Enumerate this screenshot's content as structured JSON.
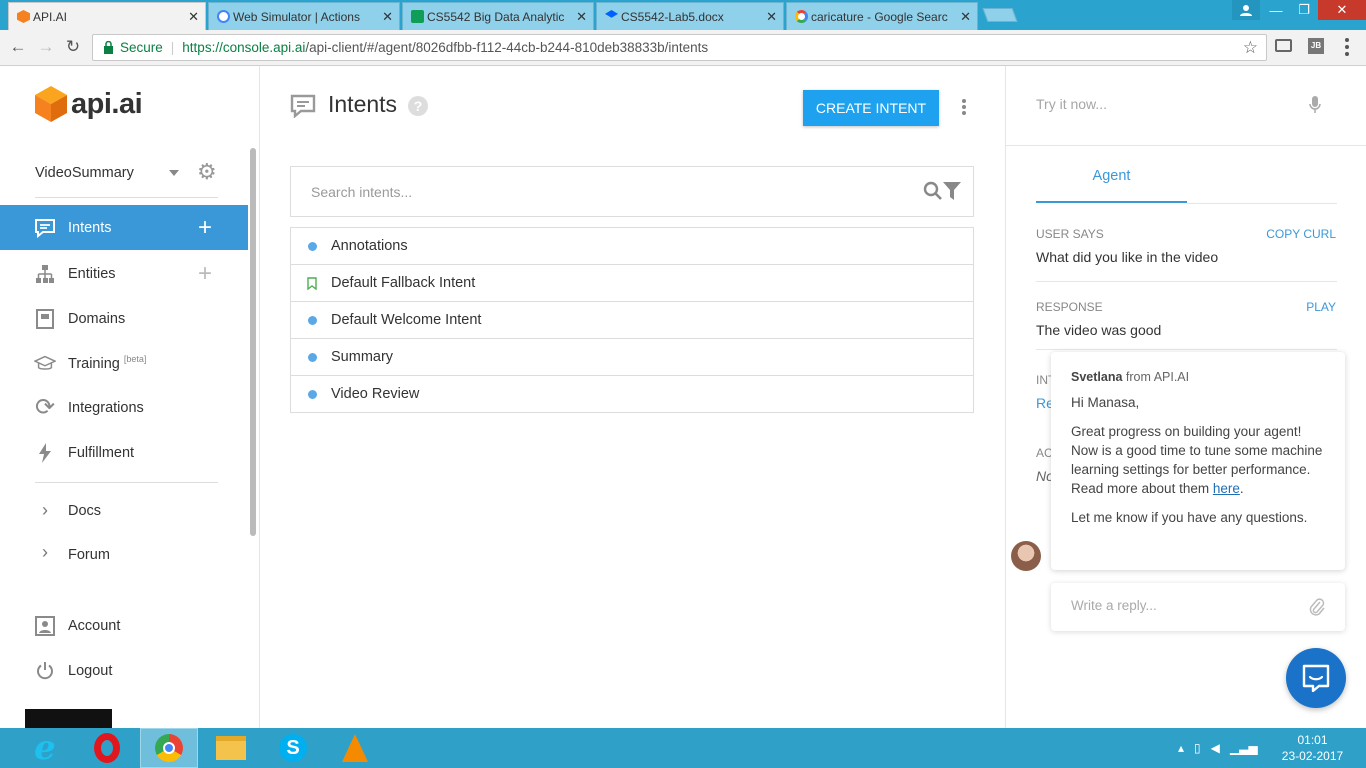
{
  "browser": {
    "tabs": [
      {
        "title": "API.AI",
        "active": true,
        "favicon": "api-ai-icon",
        "color": "#f5821f"
      },
      {
        "title": "Web Simulator  |  Actions",
        "active": false,
        "favicon": "globe-icon",
        "color": "#4285f4"
      },
      {
        "title": "CS5542 Big Data Analytic",
        "active": false,
        "favicon": "sheets-icon",
        "color": "#0f9d58"
      },
      {
        "title": "CS5542-Lab5.docx",
        "active": false,
        "favicon": "dropbox-icon",
        "color": "#0061fe"
      },
      {
        "title": "caricature - Google Searc",
        "active": false,
        "favicon": "google-icon",
        "color": "#ea4335"
      }
    ],
    "close_glyph": "✕",
    "window_controls": {
      "minimize": "—",
      "restore": "❐",
      "close": "✕"
    },
    "secure_label": "Secure",
    "url_scheme_host": "https://console.api.ai",
    "url_path": "/api-client/#/agent/8026dfbb-f112-44cb-b244-810deb38833b/intents"
  },
  "sidebar": {
    "logo_text": "api.ai",
    "agent_name": "VideoSummary",
    "items": [
      {
        "label": "Intents",
        "icon": "chat-bubble-icon",
        "active": true,
        "has_plus": true
      },
      {
        "label": "Entities",
        "icon": "hierarchy-icon",
        "active": false,
        "has_plus": true
      },
      {
        "label": "Domains",
        "icon": "book-icon",
        "active": false,
        "has_plus": false
      },
      {
        "label": "Training",
        "sup": "[beta]",
        "icon": "graduation-cap-icon",
        "active": false,
        "has_plus": false
      },
      {
        "label": "Integrations",
        "icon": "sync-icon",
        "active": false,
        "has_plus": false
      },
      {
        "label": "Fulfillment",
        "icon": "lightning-icon",
        "active": false,
        "has_plus": false
      }
    ],
    "secondary": [
      {
        "label": "Docs",
        "icon": "chevron-right-icon"
      },
      {
        "label": "Forum",
        "icon": "chevron-right-icon"
      }
    ],
    "account_label": "Account",
    "logout_label": "Logout"
  },
  "main": {
    "title": "Intents",
    "help_glyph": "?",
    "create_button": "CREATE INTENT",
    "search_placeholder": "Search intents...",
    "intents": [
      {
        "name": "Annotations",
        "marker": "dot"
      },
      {
        "name": "Default Fallback Intent",
        "marker": "bookmark"
      },
      {
        "name": "Default Welcome Intent",
        "marker": "dot"
      },
      {
        "name": "Summary",
        "marker": "dot"
      },
      {
        "name": "Video Review",
        "marker": "dot"
      }
    ]
  },
  "test_console": {
    "try_placeholder": "Try it now...",
    "tab_agent": "Agent",
    "user_says_label": "USER SAYS",
    "copy_curl": "COPY CURL",
    "user_says_value": "What did you like in the video",
    "response_label": "RESPONSE",
    "play_label": "PLAY",
    "response_value": "The video was good",
    "intent_label_partial": "INT",
    "intent_value_partial": "Re",
    "action_label_partial": "AC",
    "action_value_partial": "No"
  },
  "chat": {
    "sender": "Svetlana",
    "from_text": "from API.AI",
    "greeting": "Hi Manasa,",
    "message_before_link": "Great progress on building your agent! Now is a good time to tune some machine learning settings for better performance. Read more about them",
    "link_text": "here",
    "message_after_link": ".",
    "closing": "Let me know if you have any questions.",
    "reply_placeholder": "Write a reply..."
  },
  "taskbar": {
    "apps": [
      {
        "name": "internet-explorer-icon",
        "active": false
      },
      {
        "name": "opera-icon",
        "active": false
      },
      {
        "name": "chrome-icon",
        "active": true
      },
      {
        "name": "file-explorer-icon",
        "active": false
      },
      {
        "name": "skype-icon",
        "active": false
      },
      {
        "name": "vlc-icon",
        "active": false
      }
    ],
    "time": "01:01",
    "date": "23-02-2017"
  },
  "colors": {
    "accent": "#3b98d8",
    "create_button": "#1ea2ef",
    "chrome_tabbar": "#2aa3cf",
    "taskbar": "#2fa0c8"
  }
}
